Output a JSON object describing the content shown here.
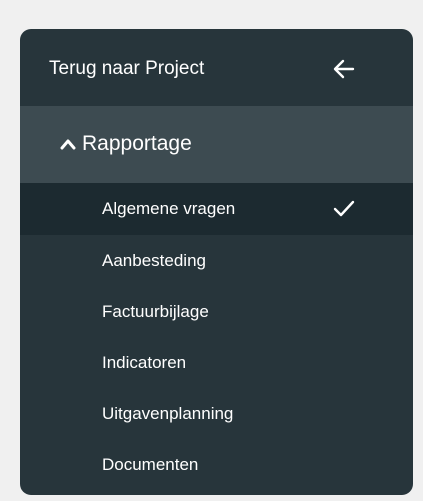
{
  "nav": {
    "back_label": "Terug naar Project",
    "back_icon": "arrow-left-icon",
    "section": {
      "label": "Rapportage",
      "icon": "chevron-up-icon",
      "expanded": true
    },
    "items": [
      {
        "label": "Algemene vragen",
        "active": true,
        "icon": "checkmark-icon"
      },
      {
        "label": "Aanbesteding",
        "active": false
      },
      {
        "label": "Factuurbijlage",
        "active": false
      },
      {
        "label": "Indicatoren",
        "active": false
      },
      {
        "label": "Uitgavenplanning",
        "active": false
      },
      {
        "label": "Documenten",
        "active": false
      }
    ]
  },
  "colors": {
    "page_background": "#f0f0f0",
    "panel_background": "#27353b",
    "section_background": "#3d4b51",
    "active_item_background": "#1c2a30",
    "text": "#ffffff"
  }
}
